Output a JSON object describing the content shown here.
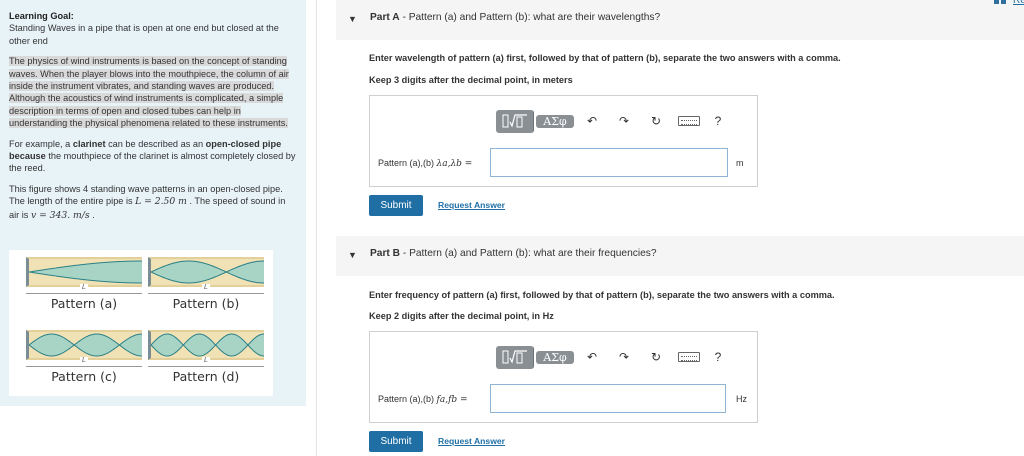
{
  "left_panel": {
    "goal_title": "Learning Goal:",
    "goal_text": "Standing Waves in a pipe that is open at one end but closed at the other end",
    "intro": "The physics of wind instruments is based on the concept of standing waves.  When the player blows into the mouthpiece, the column of air inside the instrument vibrates, and standing waves are produced. Although the acoustics of wind instruments is complicated, a simple description in terms of open and closed  tubes can help in understanding the physical phenomena related to these instruments.",
    "example_a": "For example, a ",
    "example_clarinet": "clarinet",
    "example_b": " can be described as an ",
    "example_open_closed": "open-closed pipe because",
    "example_c": " the mouthpiece of the clarinet is almost completely closed by the reed.",
    "figure_text_a": "This figure shows 4 standing wave patterns in an open-closed pipe. The length of the entire pipe is ",
    "figure_L": "L = 2.50 m",
    "figure_text_b": " . The speed of sound in air is ",
    "figure_v": "v = 343. m/s",
    "figure_text_c": " .",
    "figure": {
      "length_symbol": "L",
      "patterns": [
        {
          "label": "Pattern (a)",
          "harmonic": 1
        },
        {
          "label": "Pattern (b)",
          "harmonic": 3
        },
        {
          "label": "Pattern (c)",
          "harmonic": 5
        },
        {
          "label": "Pattern (d)",
          "harmonic": 7
        }
      ]
    }
  },
  "part_a": {
    "prefix": "Part A",
    "title": " - Pattern (a) and Pattern (b): what are their wavelengths?",
    "instruction": "Enter wavelength of pattern (a) first, followed by that of pattern (b), separate the two answers with a comma.",
    "precision": "Keep 3 digits after the decimal point, in meters",
    "eq_label": "Pattern (a),(b)",
    "eq_vars": "λa,λb =",
    "input_value": "",
    "unit": "m",
    "submit": "Submit",
    "request": "Request Answer"
  },
  "part_b": {
    "prefix": "Part B",
    "title": " - Pattern (a) and Pattern (b): what are their frequencies?",
    "instruction": "Enter frequency of pattern (a) first, followed by that of pattern (b), separate the two answers with a comma.",
    "precision": "Keep 2 digits after the decimal point, in Hz",
    "eq_label": "Pattern (a),(b)",
    "eq_vars": "fa,fb =",
    "input_value": "",
    "unit": "Hz",
    "submit": "Submit",
    "request": "Request Answer"
  },
  "toolbar": {
    "templates_icon": "radical-fraction-icon",
    "symbols_label": "ΑΣφ",
    "undo": "↶",
    "redo": "↷",
    "reset": "↻",
    "help": "?"
  },
  "corner_text": "Re"
}
